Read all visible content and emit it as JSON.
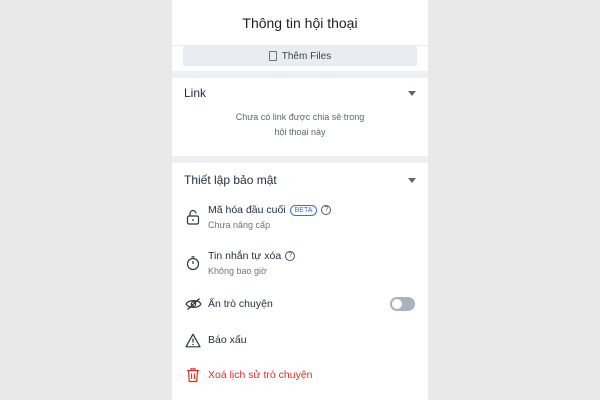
{
  "header": {
    "title": "Thông tin hội thoại"
  },
  "files": {
    "add_label": "Thêm Files"
  },
  "link_section": {
    "title": "Link",
    "empty_line1": "Chưa có link được chia sẻ trong",
    "empty_line2": "hội thoại này"
  },
  "security_section": {
    "title": "Thiết lập bảo mật",
    "items": [
      {
        "title": "Mã hóa đầu cuối",
        "badge": "BETA",
        "help": "?",
        "sub": "Chưa nâng cấp",
        "icon": "lock-open-icon"
      },
      {
        "title": "Tin nhắn tự xóa",
        "help": "?",
        "sub": "Không bao giờ",
        "icon": "timer-icon"
      },
      {
        "title": "Ẩn trò chuyện",
        "icon": "eye-off-icon",
        "toggle_on": false
      },
      {
        "title": "Báo xấu",
        "icon": "warning-icon"
      },
      {
        "title": "Xoá lịch sử trò chuyện",
        "icon": "trash-icon",
        "color": "#d93025"
      }
    ]
  },
  "colors": {
    "accent": "#2b75d8",
    "danger": "#d93025",
    "toggle_off": "#a9b3bd",
    "separator": "#eef0f3"
  }
}
